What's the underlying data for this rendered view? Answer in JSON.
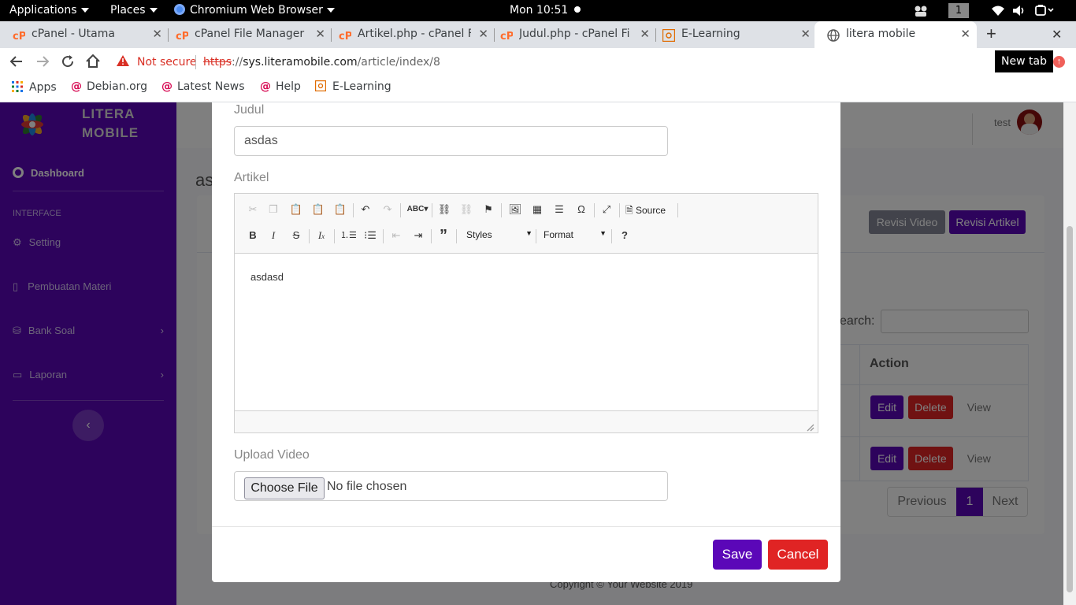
{
  "topbar": {
    "applications": "Applications",
    "places": "Places",
    "browser": "Chromium Web Browser",
    "clock": "Mon 10:51",
    "workspace": "1"
  },
  "tabs": [
    {
      "title": "cPanel - Utama",
      "icon": "cpanel-icon"
    },
    {
      "title": "cPanel File Manager",
      "icon": "cpanel-icon"
    },
    {
      "title": "Artikel.php - cPanel F",
      "icon": "cpanel-icon"
    },
    {
      "title": "Judul.php - cPanel Fi",
      "icon": "cpanel-icon"
    },
    {
      "title": "E-Learning",
      "icon": "elearning-icon"
    },
    {
      "title": "litera mobile",
      "icon": "globe-icon"
    }
  ],
  "new_tab_tooltip": "New tab",
  "address": {
    "security": "Not secure",
    "scheme": "https",
    "host": "sys.literamobile.com",
    "path": "/article/index/8"
  },
  "bookmarks": [
    "Apps",
    "Debian.org",
    "Latest News",
    "Help",
    "E-Learning"
  ],
  "sidebar": {
    "brand_line1": "LITERA",
    "brand_line2": "MOBILE",
    "dashboard": "Dashboard",
    "section": "INTERFACE",
    "items": [
      "Setting",
      "Pembuatan Materi",
      "Bank Soal",
      "Laporan"
    ]
  },
  "header": {
    "user": "test"
  },
  "background": {
    "heading_fragment": "as",
    "revisi_video": "Revisi Video",
    "revisi_artikel": "Revisi Artikel",
    "search_label": "earch:",
    "action_header": "Action",
    "row_actions": {
      "edit": "Edit",
      "delete": "Delete",
      "view": "View"
    },
    "pagination": {
      "previous": "Previous",
      "page": "1",
      "next": "Next"
    },
    "footer": "Copyright © Your Website 2019"
  },
  "modal": {
    "judul_label": "Judul",
    "judul_value": "asdas",
    "artikel_label": "Artikel",
    "editor_toolbar": {
      "source": "Source",
      "styles": "Styles",
      "format": "Format",
      "help": "?"
    },
    "editor_content": "asdasd",
    "upload_label": "Upload Video",
    "choose_file": "Choose File",
    "no_file": "No file chosen",
    "save": "Save",
    "cancel": "Cancel"
  },
  "colors": {
    "brand": "#5b07b8",
    "danger": "#e02424",
    "warning": "#d93025"
  }
}
